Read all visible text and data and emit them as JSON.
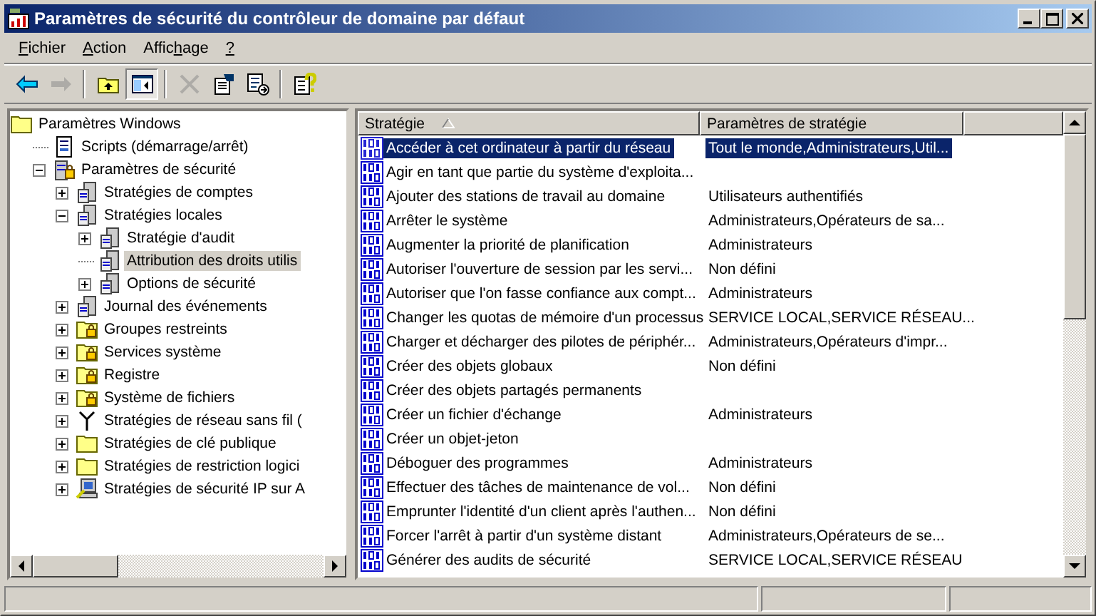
{
  "window": {
    "title": "Paramètres de sécurité du contrôleur de domaine par défaut"
  },
  "menu": [
    {
      "key": "F",
      "post": "ichier"
    },
    {
      "key": "A",
      "post": "ction"
    },
    {
      "pre": "Affic",
      "key": "h",
      "post": "age"
    },
    {
      "key": "?"
    }
  ],
  "toolbar": [
    {
      "kind": "back",
      "disabled": false,
      "pressed": false
    },
    {
      "kind": "forward",
      "disabled": true,
      "pressed": false
    },
    {
      "kind": "sep"
    },
    {
      "kind": "up",
      "disabled": false,
      "pressed": false
    },
    {
      "kind": "tree",
      "disabled": false,
      "pressed": true
    },
    {
      "kind": "sep"
    },
    {
      "kind": "delete",
      "disabled": true,
      "pressed": false
    },
    {
      "kind": "properties",
      "disabled": false,
      "pressed": false
    },
    {
      "kind": "export",
      "disabled": false,
      "pressed": false
    },
    {
      "kind": "sep"
    },
    {
      "kind": "help",
      "disabled": false,
      "pressed": false
    }
  ],
  "tree": [
    {
      "label": "Paramètres Windows",
      "kind": "folder",
      "selected": false,
      "children": [
        {
          "label": "Scripts (démarrage/arrêt)",
          "kind": "script",
          "selected": false
        },
        {
          "label": "Paramètres de sécurité",
          "kind": "security",
          "selected": false,
          "expanded": true,
          "children": [
            {
              "label": "Stratégies de comptes",
              "kind": "policy",
              "selected": false,
              "expanded": false
            },
            {
              "label": "Stratégies locales",
              "kind": "policy",
              "selected": false,
              "expanded": true,
              "children": [
                {
                  "label": "Stratégie d'audit",
                  "kind": "policy",
                  "selected": false,
                  "expanded": false
                },
                {
                  "label": "Attribution des droits utilis",
                  "kind": "policy",
                  "selected": true
                },
                {
                  "label": "Options de sécurité",
                  "kind": "policy",
                  "selected": false,
                  "expanded": false
                }
              ]
            },
            {
              "label": "Journal des événements",
              "kind": "policy",
              "selected": false,
              "expanded": false
            },
            {
              "label": "Groupes restreints",
              "kind": "lockfolder",
              "selected": false,
              "expanded": false
            },
            {
              "label": "Services système",
              "kind": "lockfolder",
              "selected": false,
              "expanded": false
            },
            {
              "label": "Registre",
              "kind": "lockfolder",
              "selected": false,
              "expanded": false
            },
            {
              "label": "Système de fichiers",
              "kind": "lockfolder",
              "selected": false,
              "expanded": false
            },
            {
              "label": "Stratégies de réseau sans fil (",
              "kind": "antenna",
              "selected": false,
              "expanded": false
            },
            {
              "label": "Stratégies de clé publique",
              "kind": "folder",
              "selected": false,
              "expanded": false
            },
            {
              "label": "Stratégies de restriction logici",
              "kind": "folder",
              "selected": false,
              "expanded": false
            },
            {
              "label": "Stratégies de sécurité IP sur A",
              "kind": "ipsec",
              "selected": false,
              "expanded": false
            }
          ]
        }
      ]
    }
  ],
  "table": {
    "columns": [
      "Stratégie",
      "Paramètres de stratégie"
    ],
    "rows": [
      {
        "policy": "Accéder à cet ordinateur à partir du réseau",
        "setting": "Tout le monde,Administrateurs,Util...",
        "selected": true
      },
      {
        "policy": "Agir en tant que partie du système d'exploita...",
        "selected": false
      },
      {
        "policy": "Ajouter des stations de travail au domaine",
        "setting": "Utilisateurs authentifiés",
        "selected": false
      },
      {
        "policy": "Arrêter le système",
        "setting": "Administrateurs,Opérateurs de sa...",
        "selected": false
      },
      {
        "policy": "Augmenter la priorité de planification",
        "setting": "Administrateurs",
        "selected": false
      },
      {
        "policy": "Autoriser l'ouverture de session par les servi...",
        "setting": "Non défini",
        "selected": false
      },
      {
        "policy": "Autoriser que l'on fasse confiance aux compt...",
        "setting": "Administrateurs",
        "selected": false
      },
      {
        "policy": "Changer les quotas de mémoire d'un processus",
        "setting": "SERVICE LOCAL,SERVICE RÉSEAU...",
        "selected": false
      },
      {
        "policy": "Charger et décharger des pilotes de périphér...",
        "setting": "Administrateurs,Opérateurs d'impr...",
        "selected": false
      },
      {
        "policy": "Créer des objets globaux",
        "setting": "Non défini",
        "selected": false
      },
      {
        "policy": "Créer des objets partagés permanents",
        "selected": false
      },
      {
        "policy": "Créer un fichier d'échange",
        "setting": "Administrateurs",
        "selected": false
      },
      {
        "policy": "Créer un objet-jeton",
        "selected": false
      },
      {
        "policy": "Déboguer des programmes",
        "setting": "Administrateurs",
        "selected": false
      },
      {
        "policy": "Effectuer des tâches de maintenance de vol...",
        "setting": "Non défini",
        "selected": false
      },
      {
        "policy": "Emprunter l'identité d'un client après l'authen...",
        "setting": "Non défini",
        "selected": false
      },
      {
        "policy": "Forcer l'arrêt à partir d'un système distant",
        "setting": "Administrateurs,Opérateurs de se...",
        "selected": false
      },
      {
        "policy": "Générer des audits de sécurité",
        "setting": "SERVICE LOCAL,SERVICE RÉSEAU",
        "selected": false
      }
    ]
  }
}
